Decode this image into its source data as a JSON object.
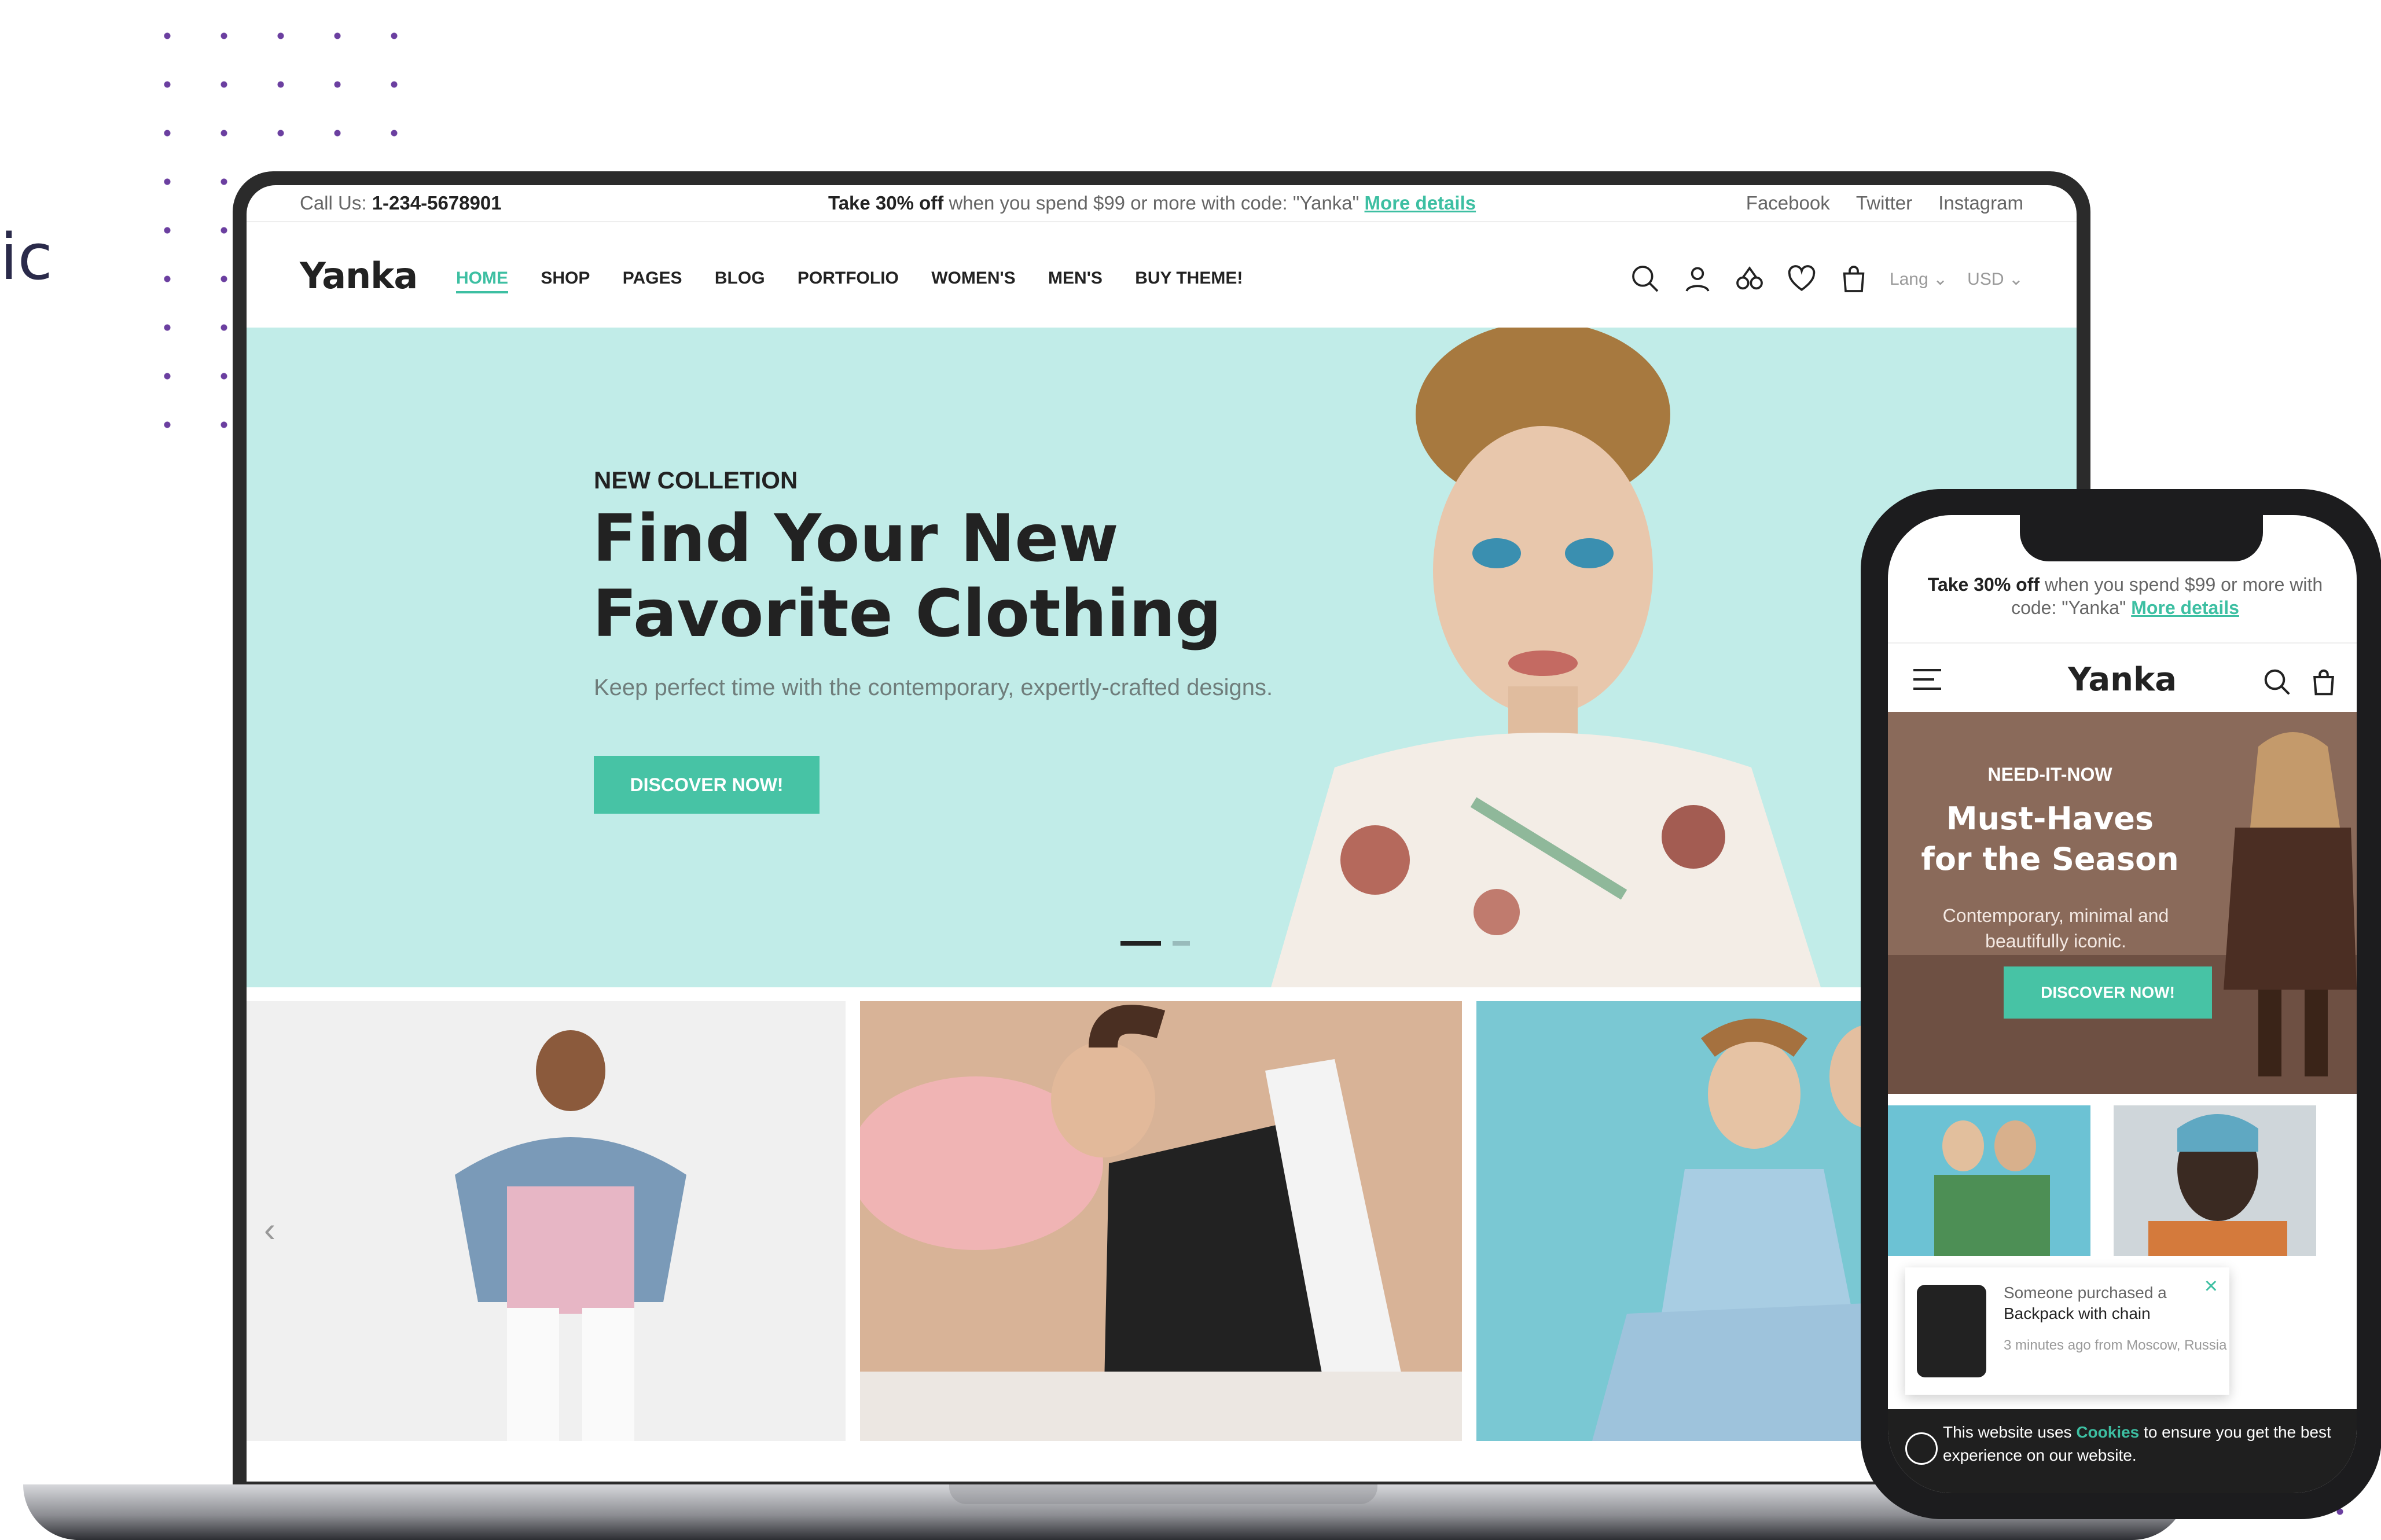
{
  "side_text": "ic",
  "desktop": {
    "topbar": {
      "call_label": "Call Us:",
      "phone": "1-234-5678901",
      "promo_bold": "Take 30% off",
      "promo_text": " when you spend $99 or more with code: \"Yanka\" ",
      "promo_link": "More details",
      "social": [
        "Facebook",
        "Twitter",
        "Instagram"
      ]
    },
    "nav": {
      "logo": "Yanka",
      "menu": [
        "HOME",
        "SHOP",
        "PAGES",
        "BLOG",
        "PORTFOLIO",
        "WOMEN'S",
        "MEN'S",
        "BUY THEME!"
      ],
      "lang": "Lang",
      "currency": "USD"
    },
    "hero": {
      "kicker": "NEW COLLETION",
      "title_line1": "Find Your New",
      "title_line2": "Favorite Clothing",
      "subtitle": "Keep perfect time with the contemporary, expertly-crafted designs.",
      "button": "DISCOVER NOW!"
    },
    "gallery": {
      "arrow": "‹"
    }
  },
  "mobile": {
    "promo_bold": "Take 30% off",
    "promo_text": " when you spend $99 or more with code: \"Yanka\" ",
    "promo_link": "More details",
    "logo": "Yanka",
    "hero": {
      "kicker": "NEED-IT-NOW",
      "title_line1": "Must-Haves",
      "title_line2": "for the Season",
      "subtitle": "Contemporary, minimal and beautifully iconic.",
      "button": "DISCOVER NOW!"
    },
    "toast": {
      "line1": "Someone purchased a",
      "line2": "Backpack with chain",
      "time": "3 minutes ago from Moscow, Russia"
    },
    "cookie": {
      "before": "This website uses ",
      "link": "Cookies",
      "after": " to ensure you get the best experience on our website."
    }
  }
}
